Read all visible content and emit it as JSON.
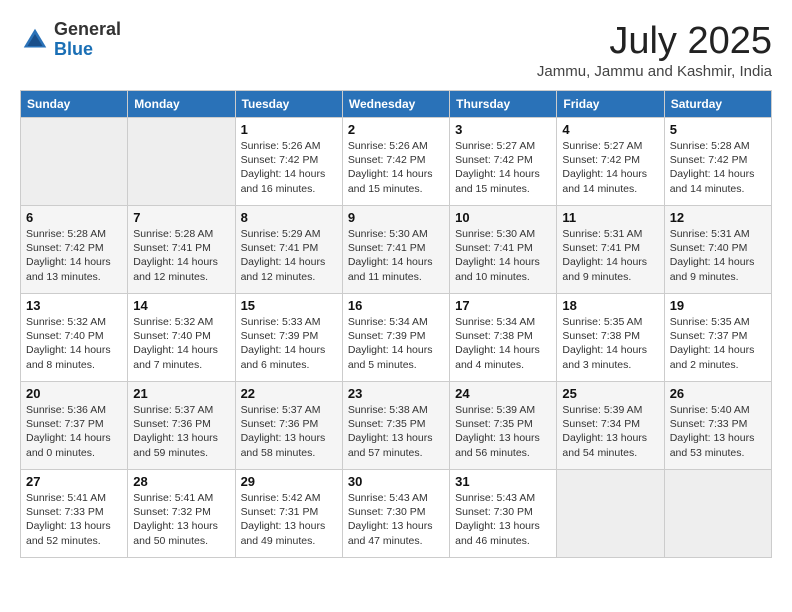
{
  "header": {
    "logo_general": "General",
    "logo_blue": "Blue",
    "month_title": "July 2025",
    "location": "Jammu, Jammu and Kashmir, India"
  },
  "days_of_week": [
    "Sunday",
    "Monday",
    "Tuesday",
    "Wednesday",
    "Thursday",
    "Friday",
    "Saturday"
  ],
  "weeks": [
    [
      {
        "day": "",
        "detail": ""
      },
      {
        "day": "",
        "detail": ""
      },
      {
        "day": "1",
        "detail": "Sunrise: 5:26 AM\nSunset: 7:42 PM\nDaylight: 14 hours and 16 minutes."
      },
      {
        "day": "2",
        "detail": "Sunrise: 5:26 AM\nSunset: 7:42 PM\nDaylight: 14 hours and 15 minutes."
      },
      {
        "day": "3",
        "detail": "Sunrise: 5:27 AM\nSunset: 7:42 PM\nDaylight: 14 hours and 15 minutes."
      },
      {
        "day": "4",
        "detail": "Sunrise: 5:27 AM\nSunset: 7:42 PM\nDaylight: 14 hours and 14 minutes."
      },
      {
        "day": "5",
        "detail": "Sunrise: 5:28 AM\nSunset: 7:42 PM\nDaylight: 14 hours and 14 minutes."
      }
    ],
    [
      {
        "day": "6",
        "detail": "Sunrise: 5:28 AM\nSunset: 7:42 PM\nDaylight: 14 hours and 13 minutes."
      },
      {
        "day": "7",
        "detail": "Sunrise: 5:28 AM\nSunset: 7:41 PM\nDaylight: 14 hours and 12 minutes."
      },
      {
        "day": "8",
        "detail": "Sunrise: 5:29 AM\nSunset: 7:41 PM\nDaylight: 14 hours and 12 minutes."
      },
      {
        "day": "9",
        "detail": "Sunrise: 5:30 AM\nSunset: 7:41 PM\nDaylight: 14 hours and 11 minutes."
      },
      {
        "day": "10",
        "detail": "Sunrise: 5:30 AM\nSunset: 7:41 PM\nDaylight: 14 hours and 10 minutes."
      },
      {
        "day": "11",
        "detail": "Sunrise: 5:31 AM\nSunset: 7:41 PM\nDaylight: 14 hours and 9 minutes."
      },
      {
        "day": "12",
        "detail": "Sunrise: 5:31 AM\nSunset: 7:40 PM\nDaylight: 14 hours and 9 minutes."
      }
    ],
    [
      {
        "day": "13",
        "detail": "Sunrise: 5:32 AM\nSunset: 7:40 PM\nDaylight: 14 hours and 8 minutes."
      },
      {
        "day": "14",
        "detail": "Sunrise: 5:32 AM\nSunset: 7:40 PM\nDaylight: 14 hours and 7 minutes."
      },
      {
        "day": "15",
        "detail": "Sunrise: 5:33 AM\nSunset: 7:39 PM\nDaylight: 14 hours and 6 minutes."
      },
      {
        "day": "16",
        "detail": "Sunrise: 5:34 AM\nSunset: 7:39 PM\nDaylight: 14 hours and 5 minutes."
      },
      {
        "day": "17",
        "detail": "Sunrise: 5:34 AM\nSunset: 7:38 PM\nDaylight: 14 hours and 4 minutes."
      },
      {
        "day": "18",
        "detail": "Sunrise: 5:35 AM\nSunset: 7:38 PM\nDaylight: 14 hours and 3 minutes."
      },
      {
        "day": "19",
        "detail": "Sunrise: 5:35 AM\nSunset: 7:37 PM\nDaylight: 14 hours and 2 minutes."
      }
    ],
    [
      {
        "day": "20",
        "detail": "Sunrise: 5:36 AM\nSunset: 7:37 PM\nDaylight: 14 hours and 0 minutes."
      },
      {
        "day": "21",
        "detail": "Sunrise: 5:37 AM\nSunset: 7:36 PM\nDaylight: 13 hours and 59 minutes."
      },
      {
        "day": "22",
        "detail": "Sunrise: 5:37 AM\nSunset: 7:36 PM\nDaylight: 13 hours and 58 minutes."
      },
      {
        "day": "23",
        "detail": "Sunrise: 5:38 AM\nSunset: 7:35 PM\nDaylight: 13 hours and 57 minutes."
      },
      {
        "day": "24",
        "detail": "Sunrise: 5:39 AM\nSunset: 7:35 PM\nDaylight: 13 hours and 56 minutes."
      },
      {
        "day": "25",
        "detail": "Sunrise: 5:39 AM\nSunset: 7:34 PM\nDaylight: 13 hours and 54 minutes."
      },
      {
        "day": "26",
        "detail": "Sunrise: 5:40 AM\nSunset: 7:33 PM\nDaylight: 13 hours and 53 minutes."
      }
    ],
    [
      {
        "day": "27",
        "detail": "Sunrise: 5:41 AM\nSunset: 7:33 PM\nDaylight: 13 hours and 52 minutes."
      },
      {
        "day": "28",
        "detail": "Sunrise: 5:41 AM\nSunset: 7:32 PM\nDaylight: 13 hours and 50 minutes."
      },
      {
        "day": "29",
        "detail": "Sunrise: 5:42 AM\nSunset: 7:31 PM\nDaylight: 13 hours and 49 minutes."
      },
      {
        "day": "30",
        "detail": "Sunrise: 5:43 AM\nSunset: 7:30 PM\nDaylight: 13 hours and 47 minutes."
      },
      {
        "day": "31",
        "detail": "Sunrise: 5:43 AM\nSunset: 7:30 PM\nDaylight: 13 hours and 46 minutes."
      },
      {
        "day": "",
        "detail": ""
      },
      {
        "day": "",
        "detail": ""
      }
    ]
  ]
}
